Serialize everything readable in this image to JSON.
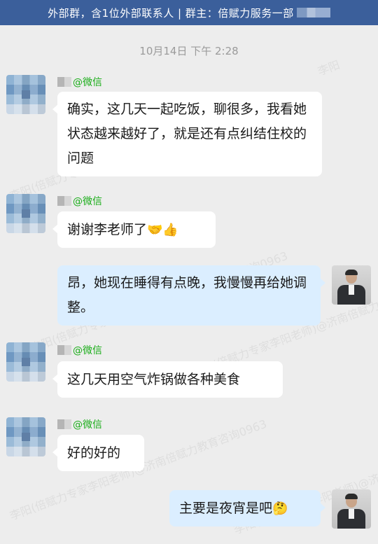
{
  "header": {
    "group_info": "外部群，含1位外部联系人 | 群主：倍赋力服务一部"
  },
  "timestamp": "10月14日 下午 2:28",
  "messages": [
    {
      "side": "left",
      "sender": "@微信",
      "text": "确实，这几天一起吃饭，聊很多，我看她状态越来越好了，就是还有点纠结住校的问题"
    },
    {
      "side": "left",
      "sender": "@微信",
      "text": "谢谢李老师了",
      "emoji": "🤝👍"
    },
    {
      "side": "right",
      "text": "昂，她现在睡得有点晚，我慢慢再给她调整。"
    },
    {
      "side": "left",
      "sender": "@微信",
      "text": "这几天用空气炸锅做各种美食"
    },
    {
      "side": "left",
      "sender": "@微信",
      "text": "好的好的"
    },
    {
      "side": "right",
      "text": "主要是夜宵是吧",
      "emoji": "🤔"
    }
  ],
  "watermarks": [
    "李阳",
    "李阳(倍赋力专家李阳老师)@济南倍赋力教育咨询0963",
    "李阳(倍赋力专家李阳老师)@济南倍赋力教育咨询0963",
    "李阳(倍赋力专家李阳老师)@济南倍赋力教育咨询0963",
    "李阳(倍赋力专家李阳老师)@济南倍赋力教育咨询0963",
    "李阳(倍赋力专家李阳老师)@济南倍赋力教育咨询0963"
  ],
  "colors": {
    "banner": "#3b5f9b",
    "sender_name": "#1aad19",
    "right_bubble": "#dbeeff",
    "left_bubble": "#ffffff",
    "background": "#ededed"
  }
}
